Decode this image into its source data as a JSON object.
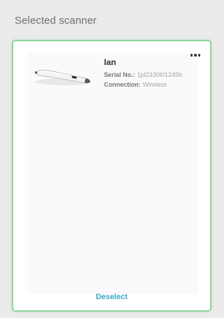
{
  "panel": {
    "title": "Selected scanner"
  },
  "scanner": {
    "name": "Ian",
    "serial_label": "Serial No.:",
    "serial_value": "1jd2330I01245b",
    "connection_label": "Connection:",
    "connection_value": "Wireless",
    "image_icon": "intraoral-scanner-icon",
    "menu_icon": "more-horizontal-icon"
  },
  "actions": {
    "deselect_label": "Deselect"
  },
  "colors": {
    "selected_border": "#8fd39a",
    "link": "#3aa8c4",
    "background": "#ebebeb"
  }
}
